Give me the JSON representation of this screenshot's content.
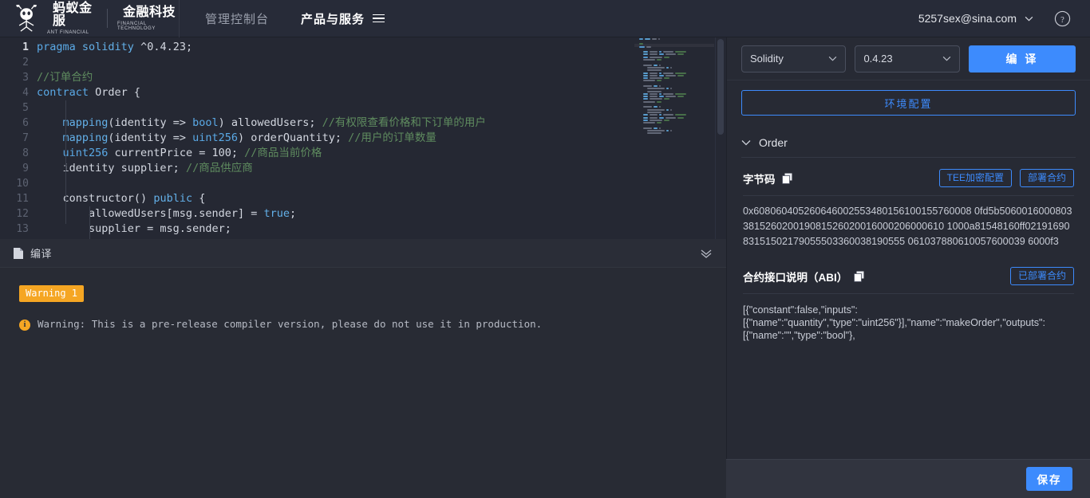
{
  "header": {
    "brand_cn": "蚂蚁金服",
    "brand_en": "ANT FINANCIAL",
    "brand2_cn": "金融科技",
    "brand2_en": "FINANCIAL TECHNOLOGY",
    "nav": [
      {
        "label": "管理控制台",
        "active": false
      },
      {
        "label": "产品与服务",
        "active": true
      }
    ],
    "user_email": "5257sex@sina.com",
    "help_label": "?"
  },
  "editor": {
    "cursor_line": 1,
    "lines": [
      {
        "n": 1,
        "tokens": [
          {
            "t": "pragma ",
            "c": "kw"
          },
          {
            "t": "solidity ",
            "c": "kw2"
          },
          {
            "t": "^0.4.23",
            "c": "txt"
          },
          {
            "t": ";",
            "c": "punc"
          }
        ]
      },
      {
        "n": 2,
        "tokens": []
      },
      {
        "n": 3,
        "tokens": [
          {
            "t": "//订单合约",
            "c": "cmt"
          }
        ]
      },
      {
        "n": 4,
        "tokens": [
          {
            "t": "contract ",
            "c": "kw"
          },
          {
            "t": "Order {",
            "c": "txt"
          }
        ]
      },
      {
        "n": 5,
        "tokens": []
      },
      {
        "n": 6,
        "tokens": [
          {
            "t": "    ",
            "c": "txt"
          },
          {
            "t": "mapping",
            "c": "kw2"
          },
          {
            "t": "(identity => ",
            "c": "txt"
          },
          {
            "t": "bool",
            "c": "type"
          },
          {
            "t": ") allowedUsers; ",
            "c": "txt"
          },
          {
            "t": "//有权限查看价格和下订单的用户",
            "c": "cmt"
          }
        ]
      },
      {
        "n": 7,
        "tokens": [
          {
            "t": "    ",
            "c": "txt"
          },
          {
            "t": "mapping",
            "c": "kw2"
          },
          {
            "t": "(identity => ",
            "c": "txt"
          },
          {
            "t": "uint256",
            "c": "type"
          },
          {
            "t": ") orderQuantity; ",
            "c": "txt"
          },
          {
            "t": "//用户的订单数量",
            "c": "cmt"
          }
        ]
      },
      {
        "n": 8,
        "tokens": [
          {
            "t": "    ",
            "c": "txt"
          },
          {
            "t": "uint256",
            "c": "type"
          },
          {
            "t": " currentPrice = 100; ",
            "c": "txt"
          },
          {
            "t": "//商品当前价格",
            "c": "cmt"
          }
        ]
      },
      {
        "n": 9,
        "tokens": [
          {
            "t": "    identity supplier; ",
            "c": "txt"
          },
          {
            "t": "//商品供应商",
            "c": "cmt"
          }
        ]
      },
      {
        "n": 10,
        "tokens": []
      },
      {
        "n": 11,
        "tokens": [
          {
            "t": "    constructor() ",
            "c": "txt"
          },
          {
            "t": "public",
            "c": "kw2"
          },
          {
            "t": " {",
            "c": "txt"
          }
        ]
      },
      {
        "n": 12,
        "tokens": [
          {
            "t": "        allowedUsers[msg.sender] = ",
            "c": "txt"
          },
          {
            "t": "true",
            "c": "kw2"
          },
          {
            "t": ";",
            "c": "txt"
          }
        ]
      },
      {
        "n": 13,
        "tokens": [
          {
            "t": "        supplier = msg.sender;",
            "c": "txt"
          }
        ]
      }
    ]
  },
  "output": {
    "title": "编译",
    "badge": "Warning 1",
    "warning_icon": "i",
    "warning_text": "Warning: This is a pre-release compiler version, please do not use it in production."
  },
  "right": {
    "language_select": {
      "value": "Solidity"
    },
    "version_select": {
      "value": "0.4.23"
    },
    "compile_button": "编 译",
    "env_button": "环境配置",
    "section_title": "Order",
    "bytecode": {
      "title": "字节码",
      "tee_button": "TEE加密配置",
      "deploy_button": "部署合约",
      "value": "0x608060405260646002553480156100155760008 0fd5b5060016000803381526020019081526020016000206000610 1000a81548160ff0219169083151502179055503360038190555 061037880610057600039 6000f3"
    },
    "abi": {
      "title": "合约接口说明（ABI）",
      "deployed_button": "已部署合约",
      "value": "[{\"constant\":false,\"inputs\":\n[{\"name\":\"quantity\",\"type\":\"uint256\"}],\"name\":\"makeOrder\",\"outputs\":\n[{\"name\":\"\",\"type\":\"bool\"},"
    }
  },
  "footer": {
    "save_button": "保存"
  },
  "colors": {
    "accent": "#3d8bfd",
    "warning": "#f5a623",
    "header_bg": "#272b38",
    "editor_bg": "#252833",
    "panel_bg": "#272a34",
    "comment": "#5f8c5f",
    "keyword": "#5aa9e6"
  }
}
